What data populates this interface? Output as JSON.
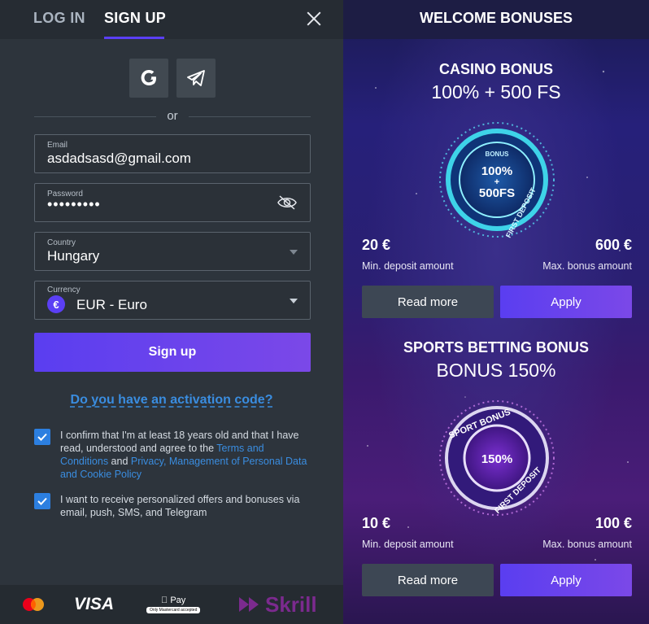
{
  "auth": {
    "tabs": [
      {
        "label": "LOG IN"
      },
      {
        "label": "SIGN UP"
      }
    ],
    "active_tab": "SIGN UP",
    "social": [
      {
        "icon": "google-icon"
      },
      {
        "icon": "telegram-icon"
      }
    ],
    "or_label": "or",
    "email": {
      "label": "Email",
      "value": "asdadsasd@gmail.com"
    },
    "password": {
      "label": "Password",
      "value": "•••••••••"
    },
    "country": {
      "label": "Country",
      "value": "Hungary"
    },
    "currency": {
      "label": "Currency",
      "symbol": "€",
      "value": "EUR - Euro"
    },
    "signup_button": "Sign up",
    "activation_link": "Do you have an activation code?",
    "consent1": {
      "text_a": "I confirm that I'm at least 18 years old and that I have read, understood and agree to the ",
      "link1": "Terms and Conditions",
      "text_b": " and ",
      "link2": "Privacy, Management of Personal Data and Cookie Policy",
      "checked": true
    },
    "consent2": {
      "text": "I want to receive personalized offers and bonuses via email, push, SMS, and Telegram",
      "checked": true
    },
    "payments": {
      "visa": "VISA",
      "applepay": "Pay",
      "applepay_note": "Only Mastercard accepted",
      "skrill": "Skrill"
    }
  },
  "bonuses": {
    "header": "WELCOME BONUSES",
    "casino": {
      "title": "CASINO BONUS",
      "subtitle": "100% + 500 FS",
      "emblem_label": "BONUS",
      "emblem_line1": "100%",
      "emblem_plus": "+",
      "emblem_line2": "500FS",
      "emblem_ring": "FIRST DEPOSIT",
      "min_amount": "20 €",
      "min_label": "Min. deposit amount",
      "max_amount": "600 €",
      "max_label": "Max. bonus amount",
      "read_more": "Read more",
      "apply": "Apply"
    },
    "sports": {
      "title": "SPORTS BETTING BONUS",
      "subtitle": "BONUS 150%",
      "emblem_top": "SPORT BONUS",
      "emblem_center": "150%",
      "emblem_ring": "FIRST DEPOSIT",
      "min_amount": "10 €",
      "min_label": "Min. deposit amount",
      "max_amount": "100 €",
      "max_label": "Max. bonus amount",
      "read_more": "Read more",
      "apply": "Apply"
    }
  },
  "colors": {
    "accent": "#5b3ff5",
    "link": "#3a8de0",
    "panel": "#2d343c"
  }
}
